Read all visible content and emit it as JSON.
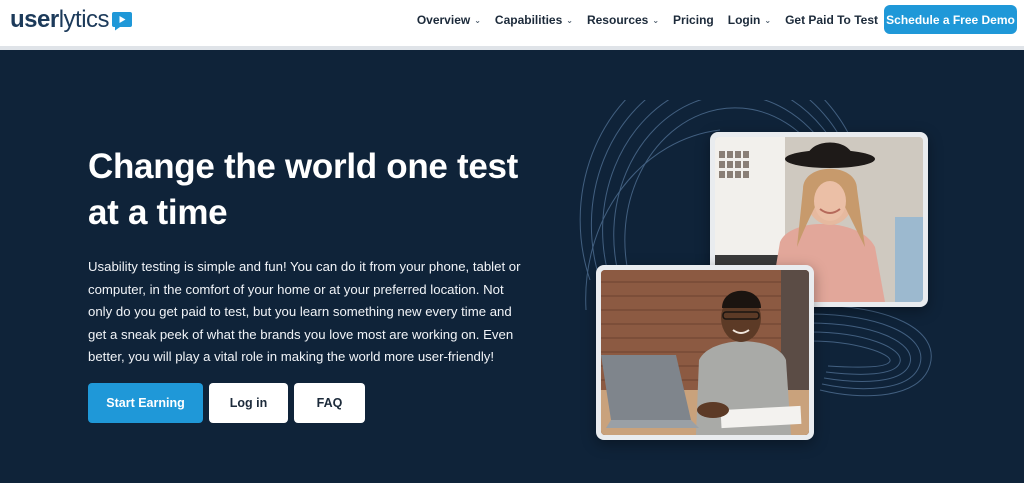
{
  "header": {
    "logo_text_bold": "user",
    "logo_text_rest": "lytics",
    "nav": [
      {
        "label": "Overview",
        "dropdown": true
      },
      {
        "label": "Capabilities",
        "dropdown": true
      },
      {
        "label": "Resources",
        "dropdown": true
      },
      {
        "label": "Pricing",
        "dropdown": false
      },
      {
        "label": "Login",
        "dropdown": true
      },
      {
        "label": "Get Paid To Test",
        "dropdown": false
      }
    ],
    "cta": "Schedule a Free Demo"
  },
  "hero": {
    "title": "Change the world one test at a time",
    "body": "Usability testing is simple and fun! You can do it from your phone, tablet or computer, in the comfort of your home or at your preferred location. Not only do you get paid to test, but you learn something new every time and get a sneak peek of what the brands you love most are working on. Even better, you will play a vital role in making the world more user-friendly!",
    "buttons": {
      "start": "Start Earning",
      "login": "Log in",
      "faq": "FAQ"
    }
  },
  "colors": {
    "background": "#0f2339",
    "accent": "#1f98d8",
    "header_bg": "#ffffff"
  },
  "icons": {
    "logo": "play-screen-icon",
    "dropdown": "chevron-down-icon"
  }
}
